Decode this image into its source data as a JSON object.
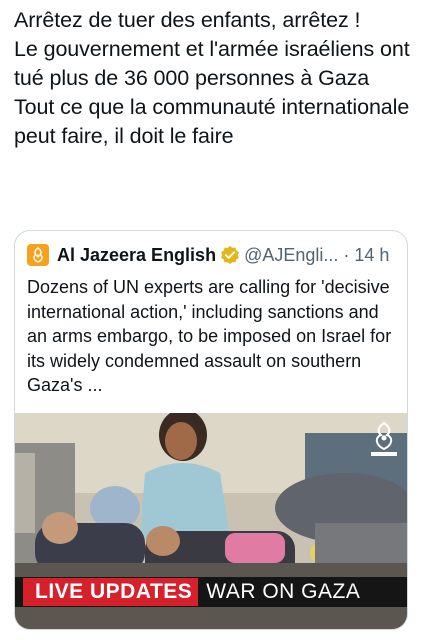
{
  "tweet": {
    "text": "Arrêtez de tuer des enfants, arrêtez !\nLe gouvernement et l'armée israéliens ont tué plus de 36 000 personnes à Gaza\nTout ce que la communauté internationale peut faire, il doit le faire"
  },
  "quote": {
    "author_name": "Al Jazeera English",
    "handle": "@AJEngli...",
    "separator": "·",
    "time": "14 h",
    "text": "Dozens of UN experts are calling for 'decisive international action,' including sanctions and an arms embargo, to be imposed on Israel for its widely condemned assault on southern Gaza's ...",
    "avatar_icon": "al-jazeera-logo-icon",
    "verified_icon": "verified-badge-icon",
    "colors": {
      "avatar": "#f6a21d",
      "verified": "#e2b719"
    }
  },
  "media": {
    "banner_live": "LIVE UPDATES",
    "banner_topic": "WAR ON GAZA",
    "colors": {
      "live_box": "#d6212d",
      "banner_bg": "#151515"
    }
  }
}
